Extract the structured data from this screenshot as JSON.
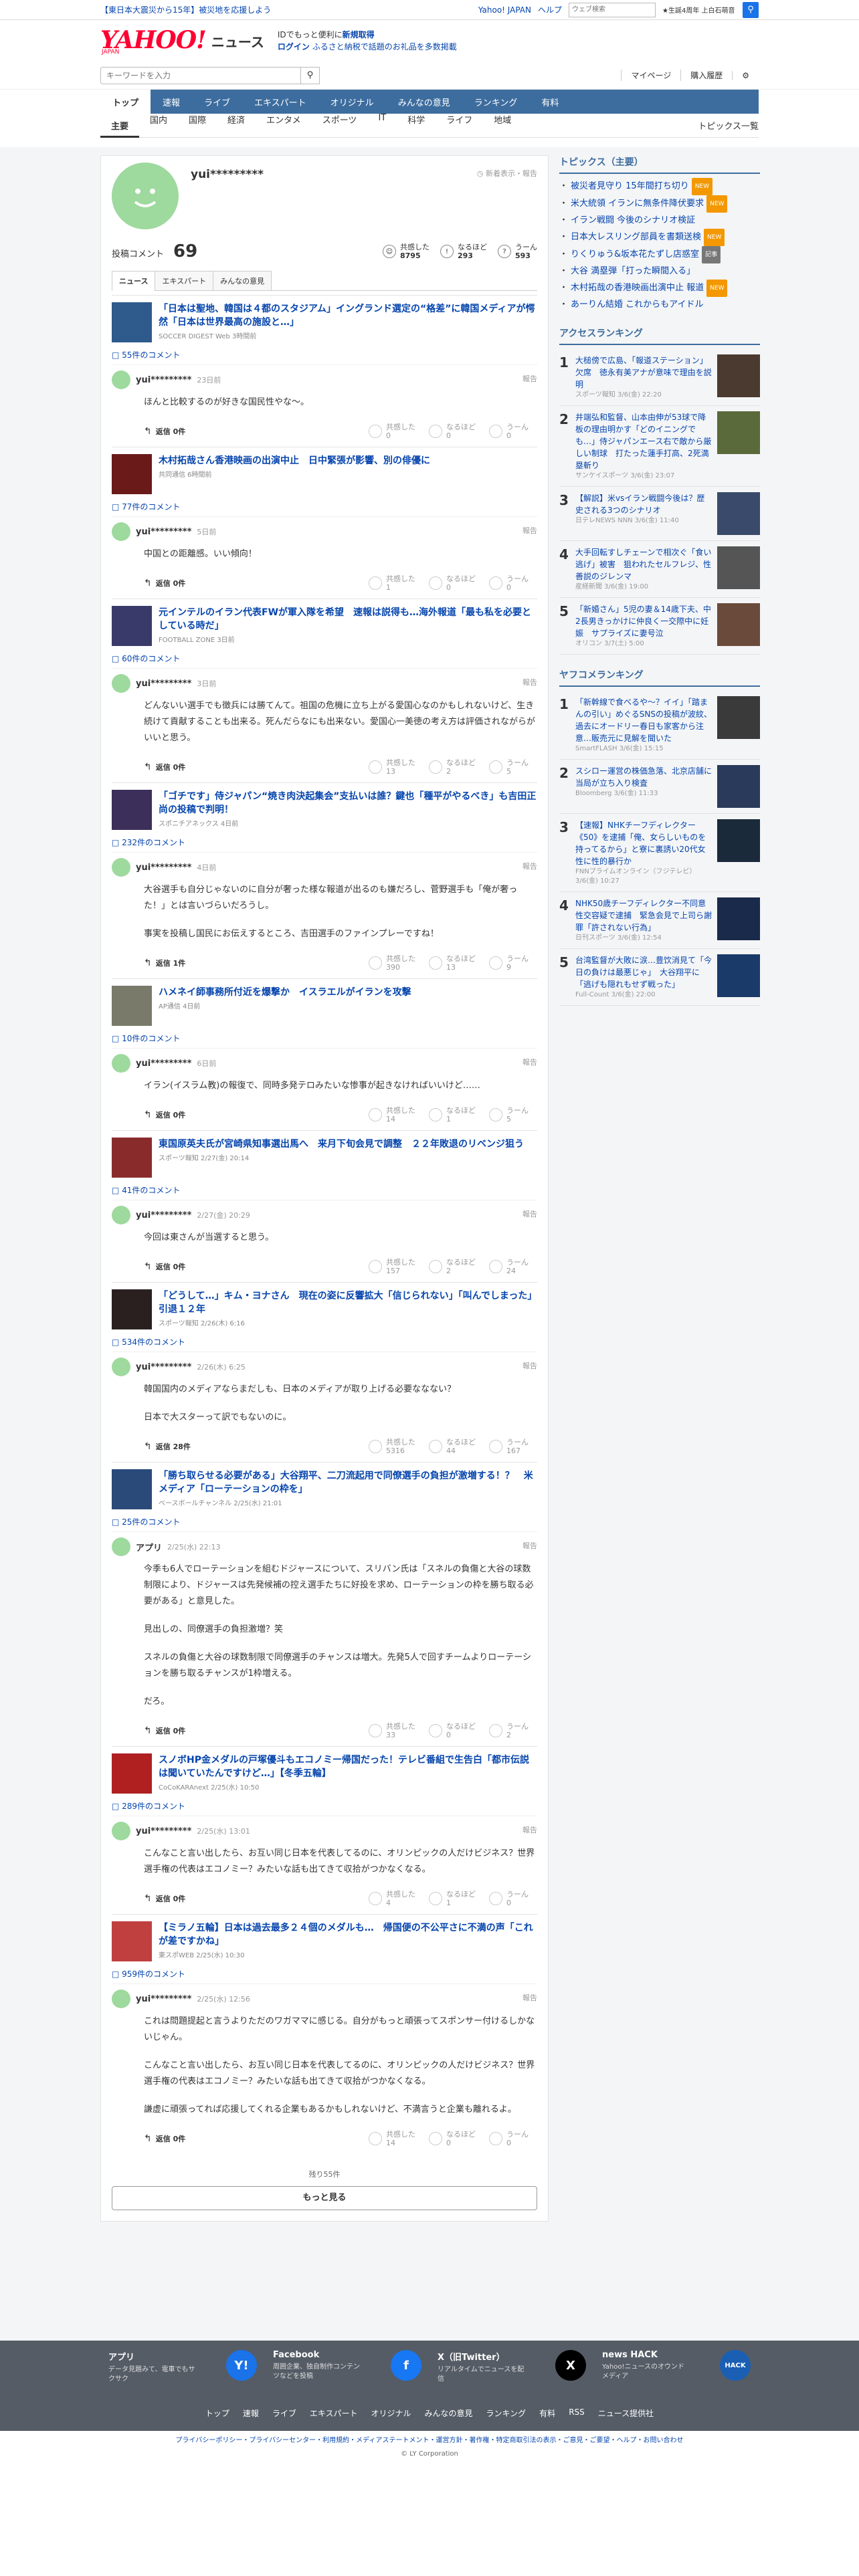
{
  "topbar": {
    "news": "【東日本大震災から15年】被災地を応援しよう",
    "links": [
      "Yahoo! JAPAN",
      "ヘルプ"
    ],
    "search_placeholder": "ウェブ検索",
    "marquee": "★生誕4周年 上白石萌音",
    "search_icon": "search-icon"
  },
  "header": {
    "logo_text": "YAHOO!",
    "logo_sub": "JAPAN",
    "service": "ニュース",
    "promo_line1": "IDでもっと便利に",
    "promo_new": "新規取得",
    "promo_line2_a": "ログイン",
    "promo_line2_b": "ふるさと納税で話題のお礼品を多数掲載"
  },
  "searchrow": {
    "placeholder": "キーワードを入力",
    "mypage": "マイページ",
    "history": "購入履歴"
  },
  "gnav": [
    "トップ",
    "速報",
    "ライブ",
    "エキスパート",
    "オリジナル",
    "みんなの意見",
    "ランキング",
    "有料"
  ],
  "cnav": {
    "items": [
      "主要",
      "国内",
      "国際",
      "経済",
      "エンタメ",
      "スポーツ",
      "IT",
      "科学",
      "ライフ",
      "地域"
    ],
    "all": "トピックス一覧"
  },
  "profile": {
    "name": "yui*********",
    "only_new": "新着表示・報告",
    "post_label": "投稿コメント",
    "post_count": "69",
    "agree_label": "共感した",
    "agree_count": "8795",
    "naruhodo_label": "なるほど",
    "naruhodo_count": "293",
    "uun_label": "うーん",
    "uun_count": "593",
    "tabs": [
      "ニュース",
      "エキスパート",
      "みんなの意見"
    ]
  },
  "entries": [
    {
      "title": "「日本は聖地、韓国は４都のスタジアム」イングランド選定の“格差”に韓国メディアが愕然「日本は世界最高の施設と…」",
      "source": "SOCCER DIGEST Web 3時間前",
      "comments": "55件のコメント",
      "thumb": "#2e5a8c",
      "user": "yui*********",
      "date": "23日前",
      "body": [
        "ほんと比較するのが好きな国民性やな〜。"
      ],
      "reply": "返信 0件",
      "agree": "0",
      "naruhodo": "0",
      "uun": "0"
    },
    {
      "title": "木村拓哉さん香港映画の出演中止　日中緊張が影響、別の俳優に",
      "source": "共同通信 6時間前",
      "comments": "77件のコメント",
      "thumb": "#6b1a1a",
      "user": "yui*********",
      "date": "5日前",
      "body": [
        "中国との距離感。いい傾向！"
      ],
      "reply": "返信 0件",
      "agree": "1",
      "naruhodo": "0",
      "uun": "0"
    },
    {
      "title": "元インテルのイラン代表FWが軍入隊を希望　速報は説得も…海外報道「最も私を必要としている時だ」",
      "source": "FOOTBALL ZONE 3日前",
      "comments": "60件のコメント",
      "thumb": "#3a3a6a",
      "user": "yui*********",
      "date": "3日前",
      "body": [
        "どんないい選手でも徴兵には勝てんて。祖国の危機に立ち上がる愛国心なのかもしれないけど、生き続けて貢献することも出来る。死んだらなにも出来ない。愛国心一美徳の考え方は評価されながらがいいと思う。"
      ],
      "reply": "返信 0件",
      "agree": "13",
      "naruhodo": "2",
      "uun": "5"
    },
    {
      "title": "「ゴチです」侍ジャパン“焼き肉決起集会”支払いは誰？鍵也「種平がやるべき」も吉田正尚の投稿で判明！",
      "source": "スポニチアネックス 4日前",
      "comments": "232件のコメント",
      "thumb": "#3c2f5a",
      "user": "yui*********",
      "date": "4日前",
      "body": [
        "大谷選手も自分じゃないのに自分が奢った様な報道が出るのも嫌だろし、菅野選手も「俺が奢った！」とは言いづらいだろうし。",
        "事実を投稿し国民にお伝えするところ、吉田選手のファインプレーですね！"
      ],
      "reply": "返信 1件",
      "agree": "390",
      "naruhodo": "13",
      "uun": "9"
    },
    {
      "title": "ハメネイ師事務所付近を爆撃か　イスラエルがイランを攻撃",
      "source": "AP通信 4日前",
      "comments": "10件のコメント",
      "thumb": "#7a7a6a",
      "user": "yui*********",
      "date": "6日前",
      "body": [
        "イラン(イスラム教)の報復で、同時多発テロみたいな惨事が起きなければいいけど……"
      ],
      "reply": "返信 0件",
      "agree": "14",
      "naruhodo": "1",
      "uun": "5"
    },
    {
      "title": "東国原英夫氏が宮崎県知事選出馬へ　来月下旬会見で調整　２２年敗退のリベンジ狙う",
      "source": "スポーツ報知 2/27(金) 20:14",
      "comments": "41件のコメント",
      "thumb": "#8a2b2b",
      "user": "yui*********",
      "date": "2/27(金) 20:29",
      "body": [
        "今回は東さんが当選すると思う。"
      ],
      "reply": "返信 0件",
      "agree": "157",
      "naruhodo": "2",
      "uun": "24"
    },
    {
      "title": "「どうして…」キム・ヨナさん　現在の姿に反響拡大「信じられない」「叫んでしまった」引退１２年",
      "source": "スポーツ報知 2/26(木) 6:16",
      "comments": "534件のコメント",
      "thumb": "#2a2020",
      "user": "yui*********",
      "date": "2/26(木) 6:25",
      "body": [
        "韓国国内のメディアならまだしも、日本のメディアが取り上げる必要ななない？",
        "日本で大スターって訳でもないのに。"
      ],
      "reply": "返信 28件",
      "agree": "5316",
      "naruhodo": "44",
      "uun": "167"
    },
    {
      "title": "「勝ち取らせる必要がある」大谷翔平、二刀流起用で同僚選手の負担が激増する！？　米メディア「ローテーションの枠を」",
      "source": "ベースボールチャンネル 2/25(水) 21:01",
      "comments": "25件のコメント",
      "thumb": "#2a4a7a",
      "user": "アプリ",
      "date": "2/25(水) 22:13",
      "body": [
        "今季も6人でローテーションを組むドジャースについて、スリバン氏は「スネルの負傷と大谷の球数制限により、ドジャースは先発候補の控え選手たちに好投を求め、ローテーションの枠を勝ち取る必要がある」と意見した。",
        "見出しの、同僚選手の負担激増？笑",
        "スネルの負傷と大谷の球数制限で同僚選手のチャンスは増大。先発5人で回すチームよりローテーションを勝ち取るチャンスが1枠増える。",
        "だろ。"
      ],
      "reply": "返信 0件",
      "agree": "33",
      "naruhodo": "0",
      "uun": "2"
    },
    {
      "title": "スノボHP金メダルの戸塚優斗もエコノミー帰国だった！テレビ番組で生告白「都市伝説は聞いていたんですけど…」【冬季五輪】",
      "source": "CoCoKARAnext 2/25(水) 10:50",
      "comments": "289件のコメント",
      "thumb": "#b02020",
      "user": "yui*********",
      "date": "2/25(水) 13:01",
      "body": [
        "こんなこと言い出したら、お互い同じ日本を代表してるのに、オリンピックの人だけビジネス？世界選手権の代表はエコノミー？みたいな話も出てきて収拾がつかなくなる。"
      ],
      "reply": "返信 0件",
      "agree": "4",
      "naruhodo": "1",
      "uun": "0"
    },
    {
      "title": "【ミラノ五輪】日本は過去最多２４個のメダルも…　帰国便の不公平さに不満の声「これが差ですかね」",
      "source": "東スポWEB 2/25(水) 10:30",
      "comments": "959件のコメント",
      "thumb": "#c04040",
      "user": "yui*********",
      "date": "2/25(水) 12:56",
      "body": [
        "これは問題提起と言うよりただのワガママに感じる。自分がもっと頑張ってスポンサー付けるしかないじゃん。",
        "こんなこと言い出したら、お互い同じ日本を代表してるのに、オリンピックの人だけビジネス？世界選手権の代表はエコノミー？みたいな話も出てきて収拾がつかなくなる。",
        "謙虚に頑張ってれば応援してくれる企業もあるかもしれないけど、不満言うと企業も離れるよ。"
      ],
      "reply": "返信 0件",
      "agree": "14",
      "naruhodo": "0",
      "uun": "0"
    }
  ],
  "vote_labels": {
    "agree": "共感した",
    "naruhodo": "なるほど",
    "uun": "うーん",
    "report": "報告"
  },
  "remain": "残り55件",
  "more": "もっと見る",
  "sidebar": {
    "topics_h": "トピックス（主要）",
    "topics": [
      {
        "t": "被災者見守り 15年間打ち切り",
        "tag": "NEW",
        "c": "#f39800"
      },
      {
        "t": "米大統領 イランに無条件降伏要求",
        "tag": "NEW",
        "c": "#f39800"
      },
      {
        "t": "イラン戦闘 今後のシナリオ検証",
        "tag": "",
        "c": ""
      },
      {
        "t": "日本大レスリング部員を書類送検",
        "tag": "NEW",
        "c": "#f39800"
      },
      {
        "t": "りくりゅう&坂本花たずし店惑室",
        "tag": "記事",
        "c": "#777"
      },
      {
        "t": "大谷 満塁弾「打った瞬間入る」",
        "tag": "",
        "c": ""
      },
      {
        "t": "木村拓哉の香港映画出演中止 報道",
        "tag": "NEW",
        "c": "#f39800"
      },
      {
        "t": "あーりん結婚 これからもアイドル",
        "tag": "",
        "c": ""
      }
    ],
    "access_h": "アクセスランキング",
    "access": [
      {
        "t": "大槌傍で広島、「報道ステーション」欠席　徳永有美アナが意味で理由を説明",
        "s": "スポーツ報知 3/6(金) 22:20",
        "c": "#4a3a30"
      },
      {
        "t": "井端弘和監督、山本由伸が53球で降板の理由明かす「どのイニングでも…」侍ジャパンエース右で敵から厳しい制球　打たった蓮手打高、2死満塁斬り",
        "s": "サンケイスポーツ 3/6(金) 23:07",
        "c": "#5a6a3a"
      },
      {
        "t": "【解説】米vsイラン戦闘今後は？歴史される3つのシナリオ",
        "s": "日テレNEWS NNN 3/6(金) 11:40",
        "c": "#3a4a6a"
      },
      {
        "t": "大手回転すしチェーンで相次ぐ「食い逃げ」被害　狙われたセルフレジ、性善説のジレンマ",
        "s": "産経新聞 3/6(金) 19:00",
        "c": "#555"
      },
      {
        "t": "「新婚さん」5児の妻＆14歳下夫、中2長男きっかけに仲良く一交際中に妊娠　サプライズに妻号泣",
        "s": "オリコン 3/7(土) 5:00",
        "c": "#6a4a3a"
      }
    ],
    "yahoo_h": "ヤフコメランキング",
    "yahoo": [
      {
        "t": "「新幹線で食べるや〜？イイ」「踏まんの引い」めぐるSNSの投稿が波紋、過去にオードリー春日も家客から注意…販売元に見解を聞いた",
        "s": "SmartFLASH 3/6(金) 15:15",
        "c": "#3a3a3a"
      },
      {
        "t": "スシロー運営の株価急落、北京店舗に当局が立ち入り検査",
        "s": "Bloomberg 3/6(金) 11:33",
        "c": "#2a3a5a"
      },
      {
        "t": "【速報】NHKチーフディレクター《50》を逮捕「俺、女らしいものを持ってるから」と寮に裏誘い20代女性に性的暴行か",
        "s": "FNNプライムオンライン（フジテレビ） 3/6(金) 10:27",
        "c": "#1a2a3a"
      },
      {
        "t": "NHK50歳チーフディレクター不同意性交容疑で逮捕　緊急会見で上司ら謝罪「許されない行為」",
        "s": "日刊スポーツ 3/6(金) 12:54",
        "c": "#1a2a4a"
      },
      {
        "t": "台湾監督が大敗に涙…豊饮消見て「今日の負けは最悪じゃ」　大谷翔平に「逃げも隠れもせず戦った」",
        "s": "Full-Count 3/6(金) 22:00",
        "c": "#1a3a6a"
      }
    ]
  },
  "footer": {
    "cols": [
      {
        "h": "アプリ",
        "d": "データ見題みて、電車でもサクサク",
        "icon": "Y!",
        "c": "#1a73e8"
      },
      {
        "h": "Facebook",
        "d": "周囲企業、独自制作コンテンツなどを投稿",
        "icon": "f",
        "c": "#1877f2"
      },
      {
        "h": "X（旧Twitter）",
        "d": "リアルタイムでニュースを配信",
        "icon": "X",
        "c": "#000"
      },
      {
        "h": "news HACK",
        "d": "Yahoo!ニュースのオウンドメディア",
        "icon": "HACK",
        "c": "#1a5fb4"
      }
    ],
    "nav": [
      "トップ",
      "速報",
      "ライブ",
      "エキスパート",
      "オリジナル",
      "みんなの意見",
      "ランキング",
      "有料",
      "RSS",
      "ニュース提供社"
    ]
  },
  "legal": {
    "links": "プライバシーポリシー・プライバシーセンター・利用規約・メディアステートメント・運営方針・著作権・特定商取引法の表示・ご意見・ご要望・ヘルプ・お問い合わせ",
    "copyright": "© LY Corporation"
  }
}
